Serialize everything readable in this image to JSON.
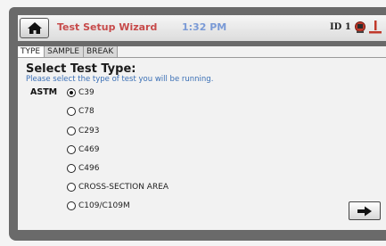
{
  "header": {
    "title": "Test Setup Wizard",
    "time": "1:32 PM",
    "id_label": "ID 1",
    "home_icon": "home-icon",
    "status_icon": "red-status-icon",
    "temp_icon": "thermometer-icon"
  },
  "tabs": [
    {
      "label": "TYPE",
      "active": true
    },
    {
      "label": "SAMPLE",
      "active": false
    },
    {
      "label": "BREAK",
      "active": false
    }
  ],
  "main": {
    "heading": "Select Test Type:",
    "subtitle": "Please select the type of test you will be running.",
    "standard": "ASTM",
    "options": [
      {
        "label": "C39",
        "selected": true
      },
      {
        "label": "C78",
        "selected": false
      },
      {
        "label": "C293",
        "selected": false
      },
      {
        "label": "C469",
        "selected": false
      },
      {
        "label": "C496",
        "selected": false
      },
      {
        "label": "CROSS-SECTION AREA",
        "selected": false
      },
      {
        "label": "C109/C109M",
        "selected": false
      }
    ],
    "next_icon": "arrow-right-icon"
  },
  "colors": {
    "frame": "#6a6a6a",
    "title": "#c74a4a",
    "time": "#7a9ad6",
    "subtitle": "#3a6fb5"
  }
}
